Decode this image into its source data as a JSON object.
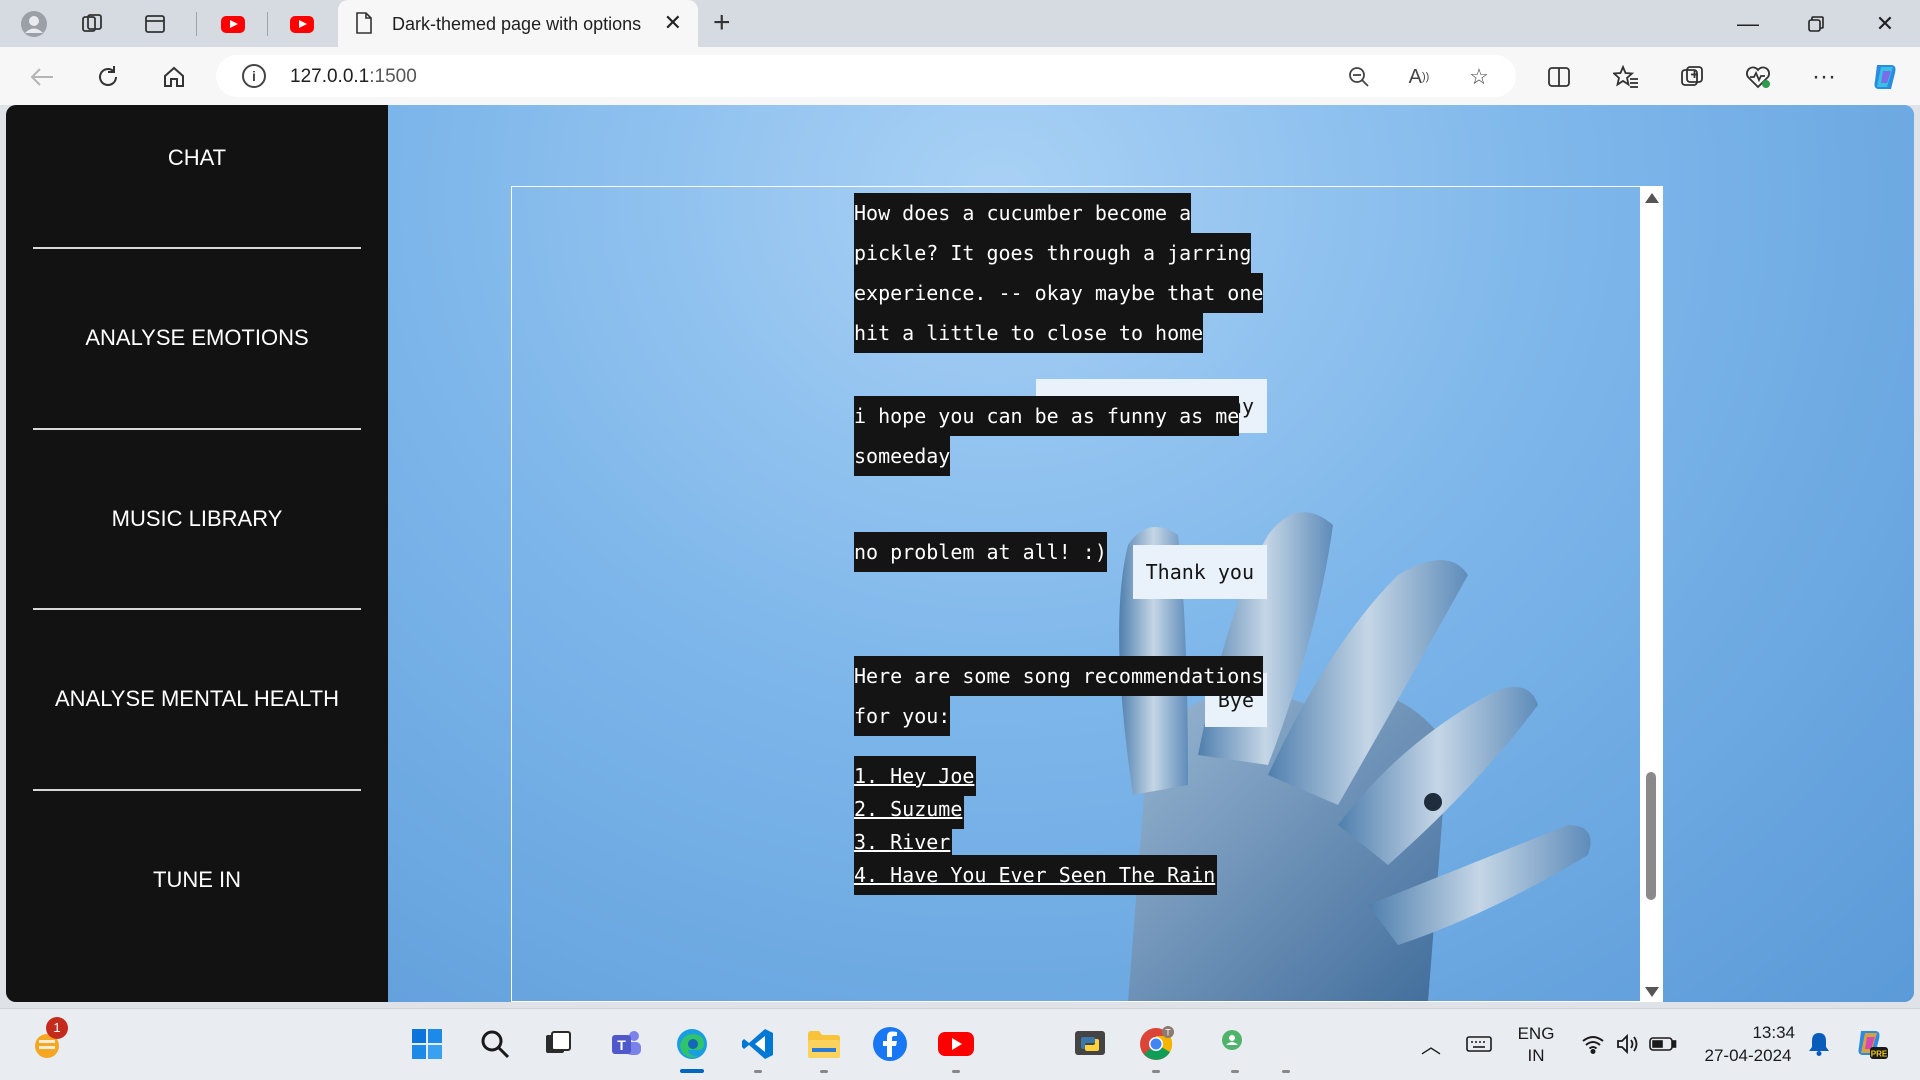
{
  "browser": {
    "tab_title": "Dark-themed page with options",
    "url_host": "127.0.0.1",
    "url_port": ":1500"
  },
  "sidebar": {
    "items": [
      {
        "label": "CHAT"
      },
      {
        "label": "ANALYSE EMOTIONS"
      },
      {
        "label": "MUSIC LIBRARY"
      },
      {
        "label": "ANALYSE MENTAL HEALTH"
      },
      {
        "label": "TUNE IN"
      }
    ]
  },
  "chat": {
    "messages": [
      {
        "from": "bot",
        "text": " How does a cucumber become a pickle? It goes through a jarring experience. -- okay maybe that one hit a little to close to home"
      },
      {
        "from": "user",
        "text": "Haha that's funny"
      },
      {
        "from": "bot",
        "text": " i hope you can be as funny as me someeday"
      },
      {
        "from": "user",
        "text": "Thank you"
      },
      {
        "from": "bot",
        "text": " no problem at all! :)"
      },
      {
        "from": "user",
        "text": "Bye"
      },
      {
        "from": "bot",
        "text": " Here are some song recommendations for you:"
      }
    ],
    "songs": [
      "1. Hey Joe",
      "2. Suzume",
      "3. River",
      "4. Have You Ever Seen The Rain"
    ]
  },
  "taskbar": {
    "notification_count": "1",
    "language": "ENG",
    "region": "IN",
    "time": "13:34",
    "date": "27-04-2024",
    "copilot_badge": "PRE"
  },
  "colors": {
    "sidebar_bg": "#121212",
    "bot_bubble": "#141414",
    "user_bubble": "#e9f2fb",
    "page_accent": "#7fb6e8"
  }
}
